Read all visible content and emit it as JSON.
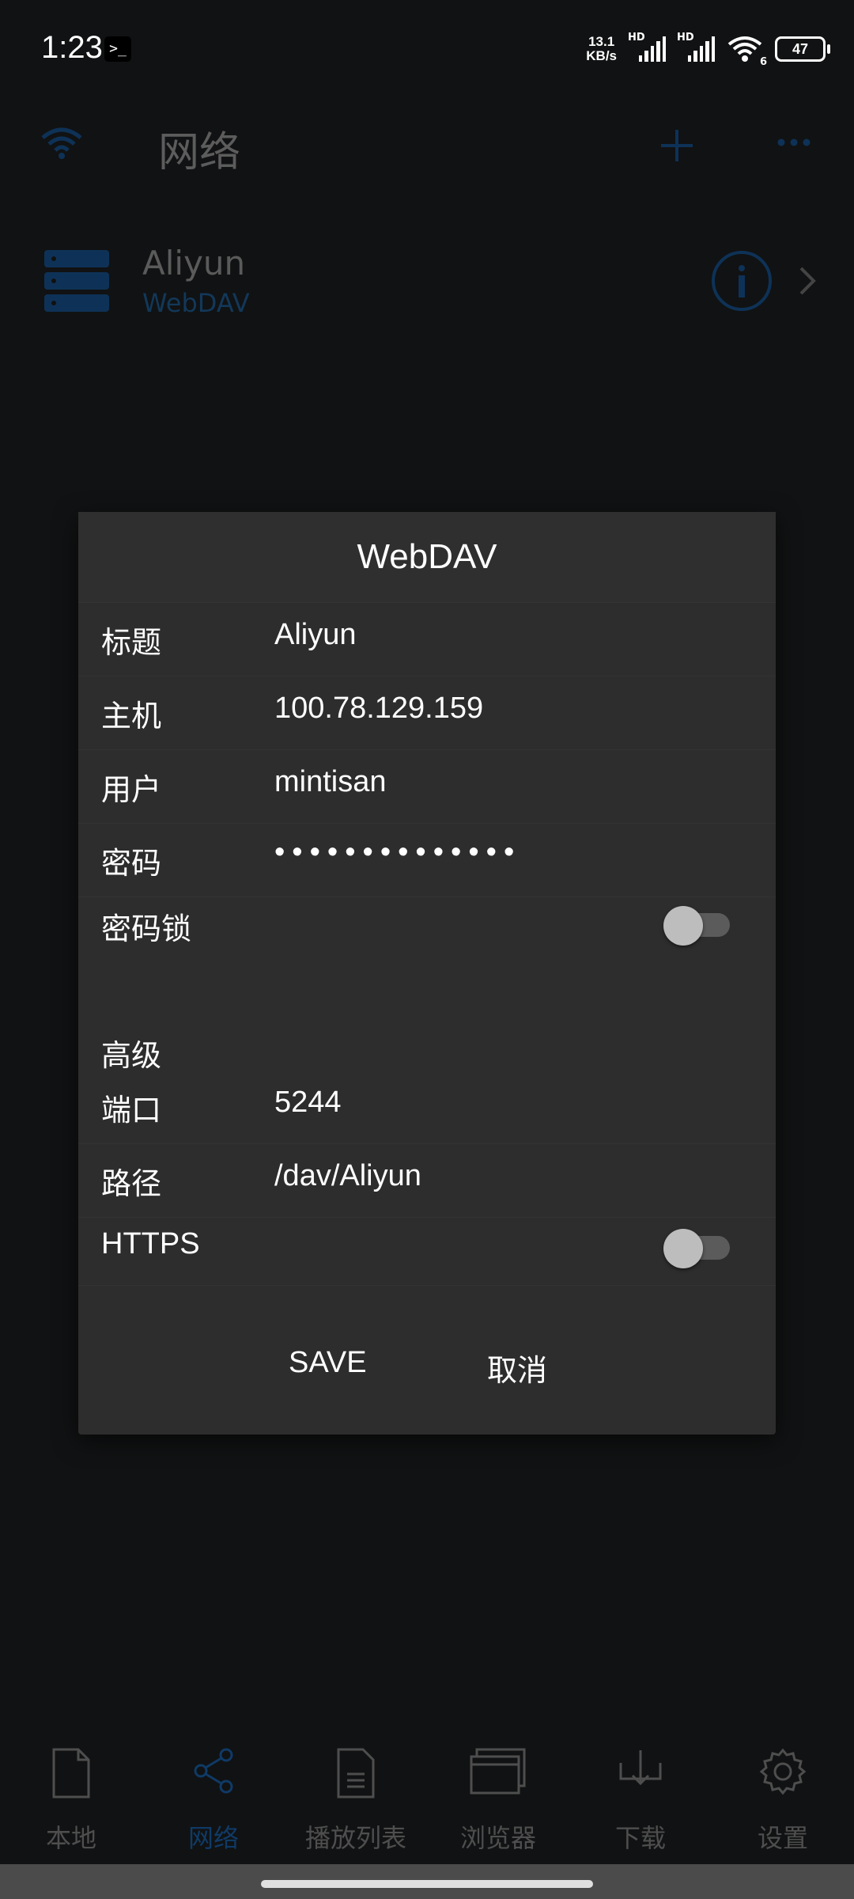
{
  "status_bar": {
    "time": "1:23",
    "terminal_glyph": ">_",
    "speed_value": "13.1",
    "speed_unit": "KB/s",
    "hd1": "HD",
    "hd2": "HD",
    "wifi_badge": "6",
    "battery": "47"
  },
  "app_bar": {
    "title": "网络",
    "icons": [
      "wifi-icon",
      "plus-icon",
      "more-icon"
    ]
  },
  "server": {
    "name": "Aliyun",
    "type": "WebDAV",
    "icons": [
      "server-icon",
      "info-icon",
      "chevron-right-icon"
    ]
  },
  "dialog": {
    "title": "WebDAV",
    "fields": {
      "title_label": "标题",
      "title_value": "Aliyun",
      "host_label": "主机",
      "host_value": "100.78.129.159",
      "user_label": "用户",
      "user_value": "mintisan",
      "password_label": "密码",
      "password_value": "••••••••••••••",
      "password_lock_label": "密码锁",
      "password_lock_on": false,
      "advanced_label": "高级",
      "port_label": "端口",
      "port_value": "5244",
      "path_label": "路径",
      "path_value": "/dav/Aliyun",
      "https_label": "HTTPS",
      "https_on": false
    },
    "save_label": "SAVE",
    "cancel_label": "取消"
  },
  "bottom_nav": {
    "items": [
      {
        "label": "本地",
        "icon": "file-icon",
        "active": false
      },
      {
        "label": "网络",
        "icon": "share-icon",
        "active": true
      },
      {
        "label": "播放列表",
        "icon": "playlist-icon",
        "active": false
      },
      {
        "label": "浏览器",
        "icon": "browser-icon",
        "active": false
      },
      {
        "label": "下载",
        "icon": "download-icon",
        "active": false
      },
      {
        "label": "设置",
        "icon": "gear-icon",
        "active": false
      }
    ]
  },
  "colors": {
    "background": "#111213",
    "dialog": "#2d2d2d",
    "accent": "#0f3a66"
  }
}
